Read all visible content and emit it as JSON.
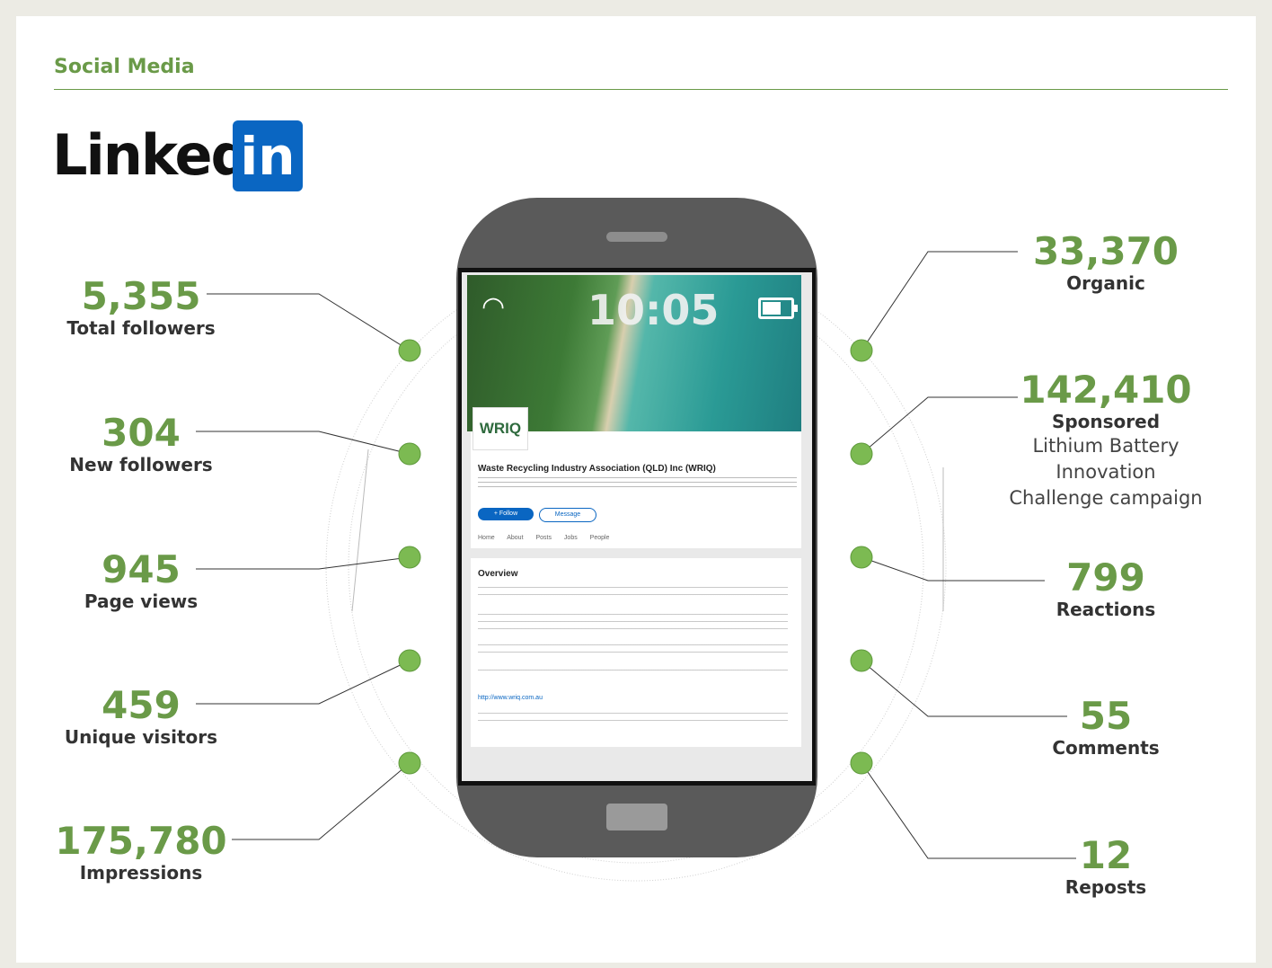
{
  "section_title": "Social Media",
  "logo": {
    "word": "Linked",
    "box": "in",
    "brand_color": "#0a66c2"
  },
  "accent_color": "#6a9a48",
  "left_stats": [
    {
      "value": "5,355",
      "label": "Total followers"
    },
    {
      "value": "304",
      "label": "New followers"
    },
    {
      "value": "945",
      "label": "Page views"
    },
    {
      "value": "459",
      "label": "Unique visitors"
    },
    {
      "value": "175,780",
      "label": "Impressions"
    }
  ],
  "right_stats": [
    {
      "value": "33,370",
      "label": "Organic"
    },
    {
      "value": "142,410",
      "label": "Sponsored",
      "sub1": "Lithium Battery Innovation",
      "sub2": "Challenge campaign"
    },
    {
      "value": "799",
      "label": "Reactions"
    },
    {
      "value": "55",
      "label": "Comments"
    },
    {
      "value": "12",
      "label": "Reposts"
    }
  ],
  "phone": {
    "time": "10:05",
    "org_logo": "WRIQ",
    "org_name": "Waste Recycling Industry Association (QLD) Inc (WRIQ)",
    "follow": "+ Follow",
    "message": "Message",
    "tabs": "Home About Posts Jobs People",
    "overview": "Overview",
    "website": "http://www.wriq.com.au"
  }
}
